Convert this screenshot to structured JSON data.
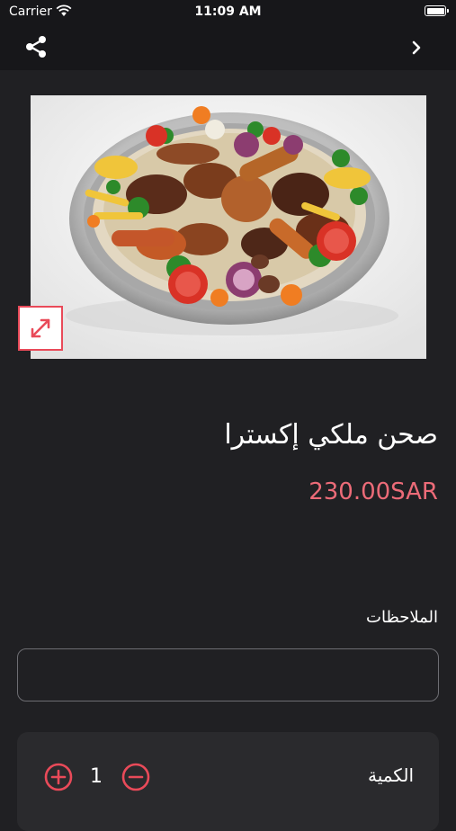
{
  "status_bar": {
    "carrier": "Carrier",
    "time": "11:09 AM"
  },
  "nav": {
    "share_icon": "share-icon",
    "forward_icon": "chevron-right-icon"
  },
  "product": {
    "name": "صحن ملكي إكسترا",
    "price": "230.00SAR",
    "image_description_icon": "expand-icon"
  },
  "notes": {
    "label": "الملاحظات",
    "value": "",
    "placeholder": ""
  },
  "quantity": {
    "label": "الكمية",
    "value": "1"
  },
  "colors": {
    "accent": "#e94a59",
    "price": "#ec6b78",
    "background": "#202023",
    "bar": "#17171a",
    "card": "#2a2a2d"
  }
}
